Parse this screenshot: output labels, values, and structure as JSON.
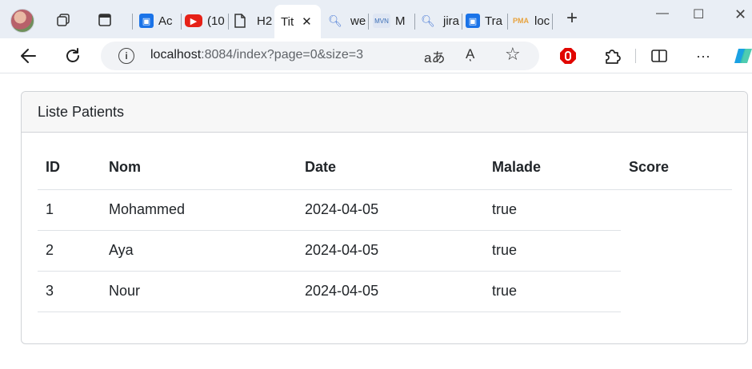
{
  "browser": {
    "tabs": [
      {
        "label": "Ac",
        "icon": "user-card-icon"
      },
      {
        "label": "(10",
        "icon": "youtube-icon"
      },
      {
        "label": "H2",
        "icon": "document-icon"
      },
      {
        "label": "Tit",
        "icon": "none",
        "active": true
      },
      {
        "label": "we",
        "icon": "search-icon"
      },
      {
        "label": "M",
        "icon": "maven-icon"
      },
      {
        "label": "jira",
        "icon": "search-icon"
      },
      {
        "label": "Tra",
        "icon": "user-card-icon"
      },
      {
        "label": "loc",
        "icon": "phpmyadmin-icon"
      }
    ],
    "active_tab_close": "✕",
    "new_tab": "+",
    "url_host": "localhost",
    "url_rest": ":8084/index?page=0&size=3",
    "info_glyph": "i",
    "reader_glyph": "aあ",
    "read_aloud_glyph": "Aͅ",
    "favorite_glyph": "☆",
    "more_glyph": "···",
    "minimize_glyph": "—",
    "maximize_glyph": "☐"
  },
  "panel": {
    "title": "Liste Patients",
    "columns": [
      "ID",
      "Nom",
      "Date",
      "Malade",
      "Score"
    ],
    "rows": [
      {
        "id": "1",
        "nom": "Mohammed",
        "date": "2024-04-05",
        "malade": "true",
        "score": ""
      },
      {
        "id": "2",
        "nom": "Aya",
        "date": "2024-04-05",
        "malade": "true",
        "score": ""
      },
      {
        "id": "3",
        "nom": "Nour",
        "date": "2024-04-05",
        "malade": "true",
        "score": ""
      }
    ]
  },
  "colors": {
    "tabbar_bg": "#e9eef5",
    "youtube_red": "#e62117",
    "profile_blue": "#1a73e8",
    "adblock_red": "#e10600",
    "copilot_blue": "#1aa1e3"
  }
}
